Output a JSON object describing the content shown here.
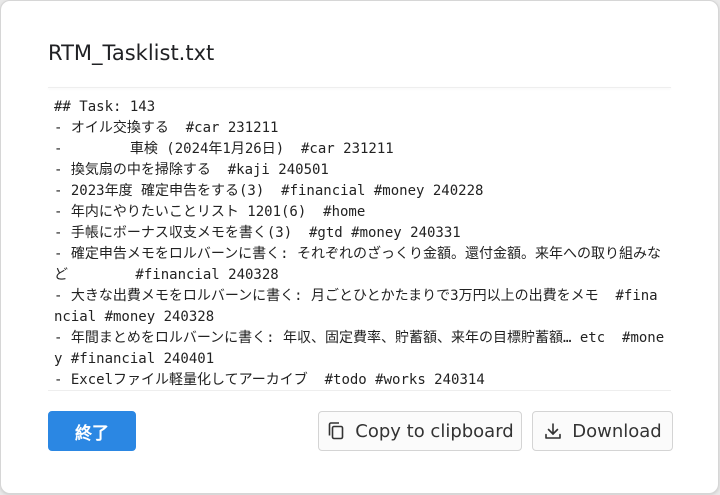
{
  "dialog": {
    "title": "RTM_Tasklist.txt",
    "content_lines": [
      "## Task: 143",
      "- オイル交換する  #car 231211",
      "-        車検 (2024年1月26日)  #car 231211",
      "- 換気扇の中を掃除する  #kaji 240501",
      "- 2023年度 確定申告をする(3)  #financial #money 240228",
      "- 年内にやりたいことリスト 1201(6)  #home",
      "- 手帳にボーナス収支メモを書く(3)  #gtd #money 240331",
      "- 確定申告メモをロルバーンに書く: それぞれのざっくり金額。還付金額。来年への取り組みなど        #financial 240328",
      "- 大きな出費メモをロルバーンに書く: 月ごとひとかたまりで3万円以上の出費をメモ  #financial #money 240328",
      "- 年間まとめをロルバーンに書く: 年収、固定費率、貯蓄額、来年の目標貯蓄額… etc  #money #financial 240401",
      "- Excelファイル軽量化してアーカイブ  #todo #works 240314"
    ]
  },
  "buttons": {
    "close_label": "終了",
    "copy_label": "Copy to clipboard",
    "copy_icon": "copy-icon",
    "download_label": "Download",
    "download_icon": "download-icon"
  },
  "colors": {
    "primary": "#2b87e3",
    "text": "#222222",
    "border": "#d4d4d4"
  }
}
